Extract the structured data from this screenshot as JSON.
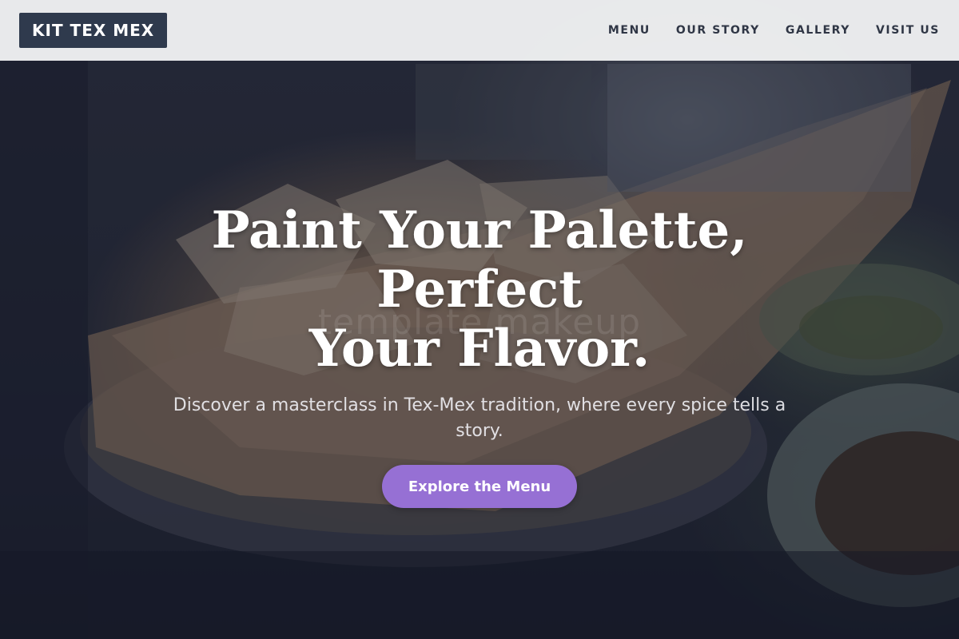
{
  "header": {
    "logo": "KIT TEX MEX",
    "nav": [
      {
        "label": "MENU"
      },
      {
        "label": "OUR STORY"
      },
      {
        "label": "GALLERY"
      },
      {
        "label": "VISIT US"
      }
    ]
  },
  "hero": {
    "title_line1": "Paint Your Palette, Perfect",
    "title_line2": "Your Flavor.",
    "watermark": "template makeup",
    "subtitle": "Discover a masterclass in Tex-Mex tradition, where every spice tells a story.",
    "cta_label": "Explore the Menu"
  },
  "colors": {
    "header_bg": "#f0f1f3",
    "logo_bg": "#2f3a4d",
    "accent": "#9670d4",
    "hero_overlay": "#141826"
  }
}
